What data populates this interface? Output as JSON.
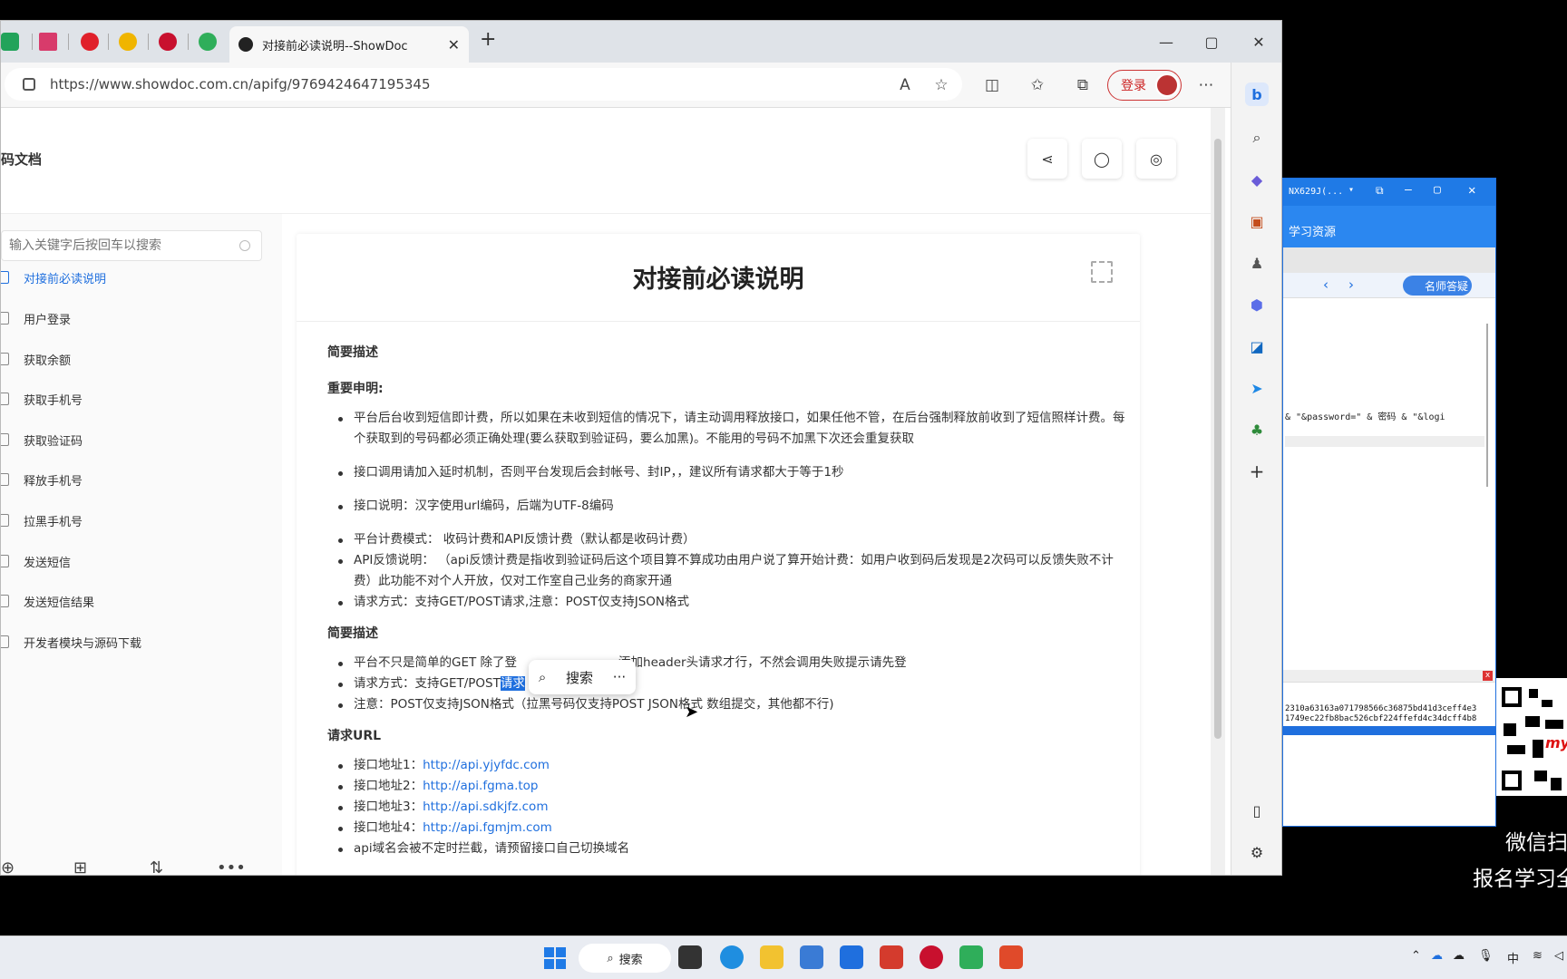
{
  "browser": {
    "tab_title": "对接前必读说明--ShowDoc",
    "url": "https://www.showdoc.com.cn/apifg/9769424647195345",
    "login_label": "登录"
  },
  "site": {
    "title": "码文档",
    "search_placeholder": "输入关键字后按回车以搜索"
  },
  "nav": [
    {
      "label": "对接前必读说明"
    },
    {
      "label": "用户登录"
    },
    {
      "label": "获取余额"
    },
    {
      "label": "获取手机号"
    },
    {
      "label": "获取验证码"
    },
    {
      "label": "释放手机号"
    },
    {
      "label": "拉黑手机号"
    },
    {
      "label": "发送短信"
    },
    {
      "label": "发送短信结果"
    },
    {
      "label": "开发者模块与源码下载"
    }
  ],
  "doc": {
    "title": "对接前必读说明",
    "h_brief1": "简要描述",
    "h_important": "重要申明:",
    "imp1": "平台后台收到短信即计费，所以如果在未收到短信的情况下，请主动调用释放接口，如果任他不管，在后台强制释放前收到了短信照样计费。每个获取到的号码都必须正确处理(要么获取到验证码，要么加黑)。不能用的号码不加黑下次还会重复获取",
    "imp2": "接口调用请加入延时机制，否则平台发现后会封帐号、封IP，，建议所有请求都大于等于1秒",
    "imp3": "接口说明：汉字使用url编码，后端为UTF-8编码",
    "imp4": "平台计费模式： 收码计费和API反馈计费（默认都是收码计费）",
    "imp5": "API反馈说明： （api反馈计费是指收到验证码后这个项目算不算成功由用户说了算开始计费：如用户收到码后发现是2次码可以反馈失败不计费）此功能不对个人开放，仅对工作室自己业务的商家开通",
    "imp6": "请求方式：支持GET/POST请求,注意：POST仅支持JSON格式",
    "h_brief2": "简要描述",
    "b1_pre": "平台不只是简单的GET 除了登",
    "b1_post": "添加header头请求才行，不然会调用失败提示请先登",
    "b2_pre": "请求方式：支持GET/POST",
    "b2_sel": "请求",
    "b3": "注意：POST仅支持JSON格式（拉黑号码仅支持POST JSON格式 数组提交，其他都不行)",
    "h_url": "请求URL",
    "urls": [
      {
        "label": "接口地址1：",
        "link": "http://api.yjyfdc.com"
      },
      {
        "label": "接口地址2：",
        "link": "http://api.fgma.top"
      },
      {
        "label": "接口地址3：",
        "link": "http://api.sdkjfz.com"
      },
      {
        "label": "接口地址4：",
        "link": "http://api.fgmjm.com"
      }
    ],
    "tail": "api域名会被不定时拦截，请预留接口自己切换域名"
  },
  "popup": {
    "search_label": "搜索",
    "more": "···"
  },
  "right_app": {
    "window_title": "NX629J(...",
    "header": "学习资源",
    "tutor": "名师答疑",
    "code_line": "& \"&password=\" & 密码 & \"&logi",
    "hash1": "2310a63163a071798566c36875bd41d3ceff4e3",
    "hash2": "1749ec22fb8bac526cbf224ffefd4c34dcff4b8"
  },
  "overlay": {
    "line1": "微信扫",
    "line2": "报名学习全",
    "qr_mark": "my"
  },
  "taskbar": {
    "search_label": "搜索",
    "ime": "中"
  }
}
